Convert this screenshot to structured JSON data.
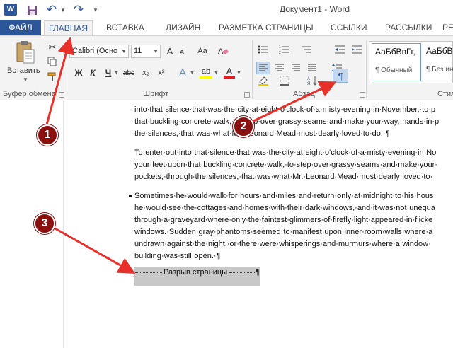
{
  "window": {
    "title": "Документ1 - Word",
    "app_icon_letter": "W"
  },
  "quick_access": {
    "save_icon": "save-icon",
    "undo_icon": "undo-icon",
    "redo_icon": "redo-icon"
  },
  "tabs": {
    "file": "ФАЙЛ",
    "items": [
      "ГЛАВНАЯ",
      "ВСТАВКА",
      "ДИЗАЙН",
      "РАЗМЕТКА СТРАНИЦЫ",
      "ССЫЛКИ",
      "РАССЫЛКИ",
      "РЕЦ"
    ]
  },
  "ribbon": {
    "clipboard": {
      "paste_label": "Вставить",
      "group_label": "Буфер обмена"
    },
    "font": {
      "font_name": "Calibri (Осно",
      "font_size": "11",
      "bold": "Ж",
      "italic": "К",
      "underline": "Ч",
      "strike": "abc",
      "subscript": "x₂",
      "superscript": "x²",
      "grow": "A",
      "shrink": "A",
      "case": "Aa",
      "effects": "A",
      "highlight": "ab",
      "color": "A",
      "group_label": "Шрифт"
    },
    "paragraph": {
      "show_marks": "¶",
      "group_label": "Абзац"
    },
    "styles": {
      "items": [
        {
          "sample": "АаБбВвГг,",
          "name": "¶ Обычный"
        },
        {
          "sample": "АаБбВв",
          "name": "¶ Без инт"
        }
      ],
      "group_label": "Стил"
    }
  },
  "document": {
    "para1": [
      "into·that·silence·that·was·the·city·at·eight·o'clock·of·a·misty·evening·in·November,·to·p",
      "that·buckling·concrete·walk,·to·step·over·grassy·seams·and·make·your·way,·hands·in·p",
      "the·silences,·that·was·what·Mr.·Leonard·Mead·most·dearly·loved·to·do.·¶"
    ],
    "para2": [
      "To·enter·out·into·that·silence·that·was·the·city·at·eight·o'clock·of·a·misty·evening·in·No",
      "your·feet·upon·that·buckling·concrete·walk,·to·step·over·grassy·seams·and·make·your·",
      "pockets,·through·the·silences,·that·was·what·Mr.·Leonard·Mead·most·dearly·loved·to·"
    ],
    "para3": [
      "Sometimes·he·would·walk·for·hours·and·miles·and·return·only·at·midnight·to·his·hous",
      "he·would·see·the·cottages·and·homes·with·their·dark·windows,·and·it·was·not·unequa",
      "through·a·graveyard·where·only·the·faintest·glimmers·of·firefly·light·appeared·in·flicke",
      "windows.·Sudden·gray·phantoms·seemed·to·manifest·upon·inner·room·walls·where·a",
      "undrawn·against·the·night,·or·there·were·whisperings·and·murmurs·where·a·window·",
      "building·was·still·open.·¶"
    ],
    "page_break_label": "Разрыв страницы",
    "page_break_pilcrow": "¶"
  },
  "annotations": {
    "badge1": "1",
    "badge2": "2",
    "badge3": "3",
    "color": "#e8302a",
    "badge_color": "#8b1010"
  }
}
